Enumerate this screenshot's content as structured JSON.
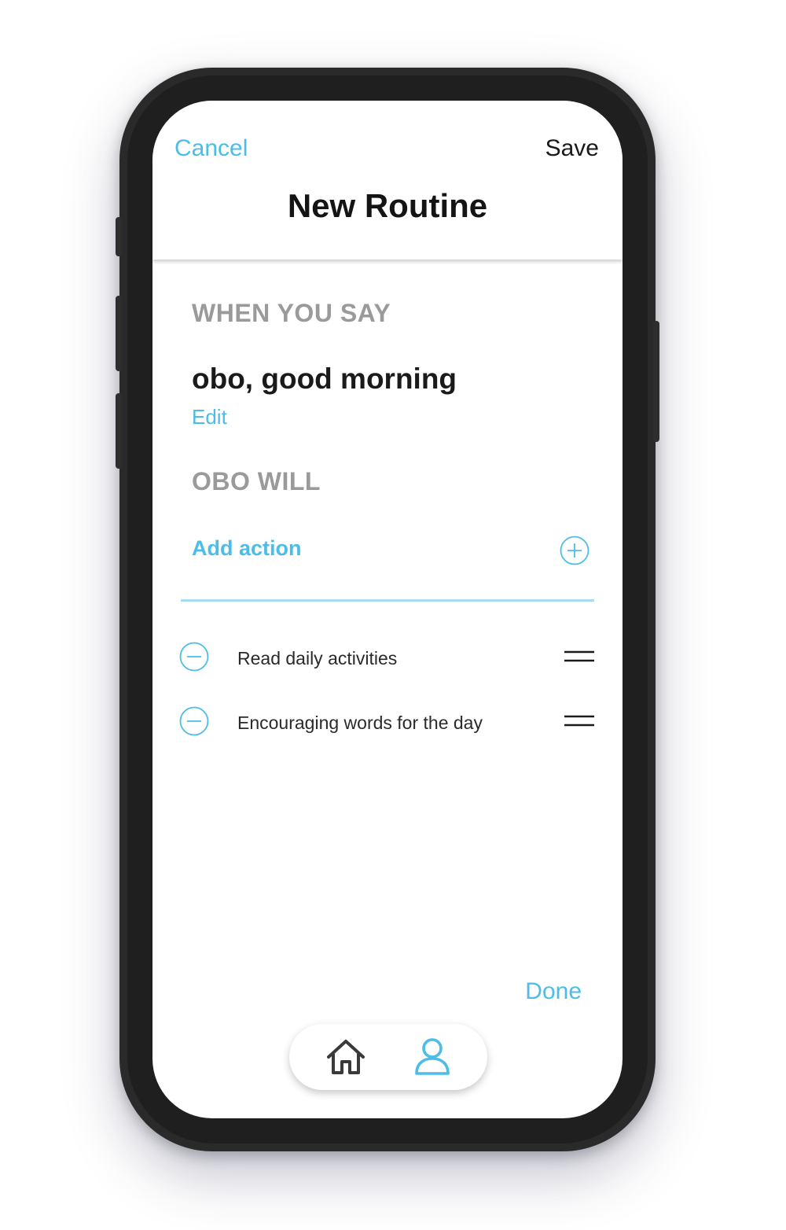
{
  "header": {
    "cancel_label": "Cancel",
    "save_label": "Save",
    "title": "New Routine"
  },
  "trigger": {
    "section_label": "WHEN YOU SAY",
    "phrase": "obo, good morning",
    "edit_label": "Edit"
  },
  "actions": {
    "section_label": "OBO WILL",
    "add_label": "Add action",
    "items": [
      {
        "label": "Read daily activities"
      },
      {
        "label": "Encouraging words for the day"
      }
    ]
  },
  "footer": {
    "done_label": "Done"
  },
  "nav": {
    "items": [
      {
        "icon": "home-icon",
        "active": false
      },
      {
        "icon": "profile-icon",
        "active": true
      }
    ]
  },
  "colors": {
    "accent": "#4bbde8",
    "section_label": "#9a9a9a",
    "divider": "#a7dbf3",
    "text": "#1a1a1a",
    "nav_inactive": "#3a3a3a"
  }
}
